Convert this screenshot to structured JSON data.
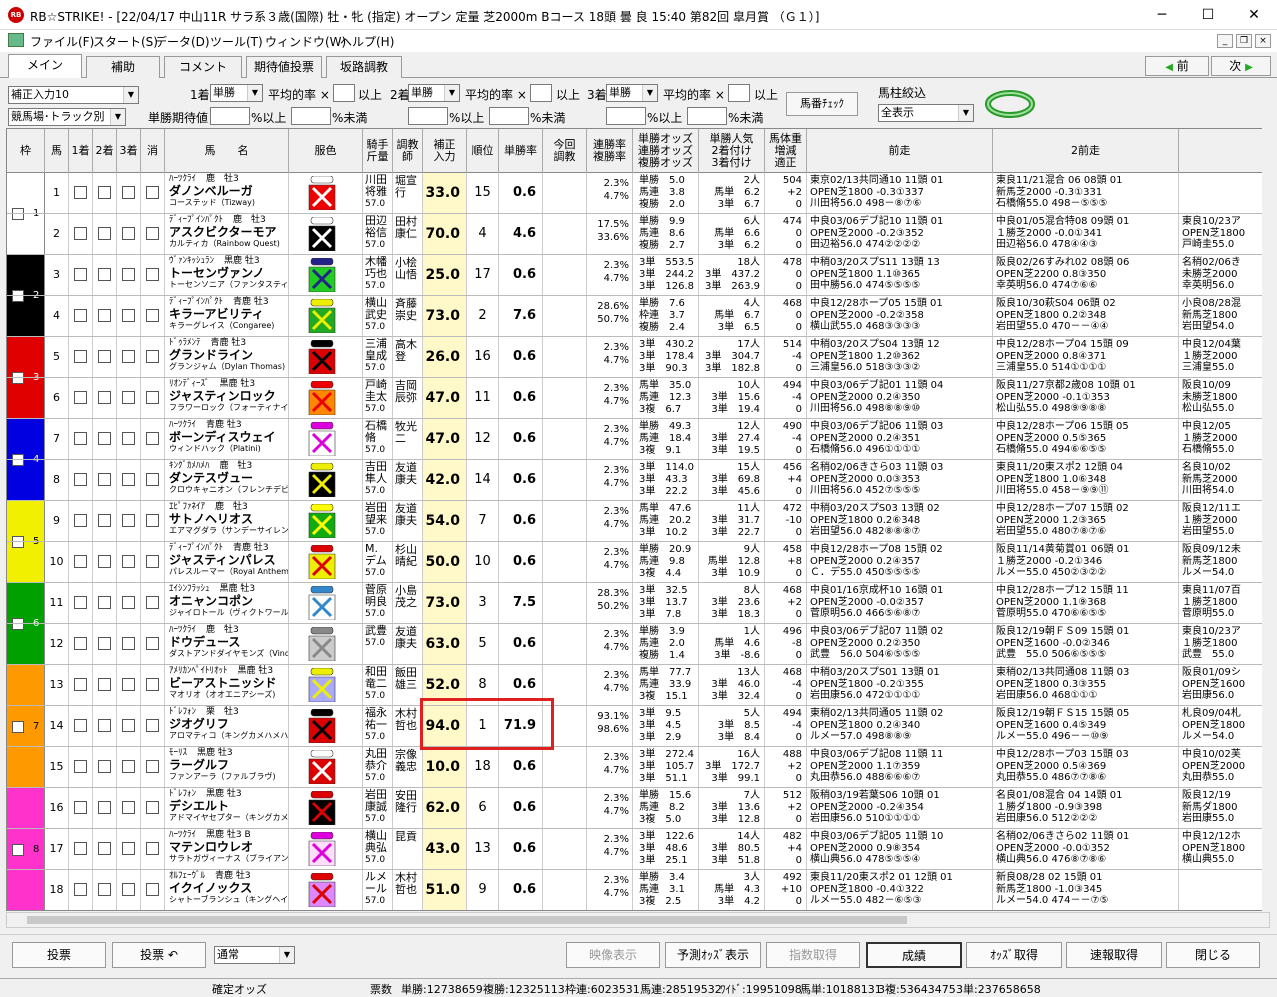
{
  "window": {
    "title": "RB☆STRIKE! - [22/04/17 中山11R サラ系３歳(国際) 牡・牝 (指定) オープン 定量 芝2000m Bコース 18頭 曇 良 15:40 第82回 皐月賞 （Ｇ１）]",
    "icon": "RB"
  },
  "menu": [
    "ファイル(F)",
    "スタート(S)",
    "データ(D)",
    "ツール(T)",
    "ウィンドウ(W)",
    "ヘルプ(H)"
  ],
  "tabs": [
    "メイン",
    "補助",
    "コメント",
    "期待値投票",
    "坂路調教"
  ],
  "nav": {
    "prev": "前",
    "next": "次"
  },
  "controls": {
    "input_mode": "補正入力10",
    "track_mode": "競馬場･トラック別",
    "first": "1着",
    "second": "2着",
    "third": "3着",
    "win": "単勝",
    "avg": "平均的率 ×",
    "above": "以上",
    "win_ev": "単勝期待値",
    "pct_above": "%以上",
    "pct_below": "%未満",
    "horse_check": "馬番ﾁｪｯｸ",
    "filter_label": "馬柱絞込",
    "filter_value": "全表示"
  },
  "headers": {
    "frame": "枠",
    "num": "馬",
    "p1": "1着",
    "p2": "2着",
    "p3": "3着",
    "scratch": "消",
    "name": "馬　　名",
    "silk": "服色",
    "jockey": "騎手\n斤量",
    "trainer": "調教\n師",
    "hosei": "補正\n入力",
    "rank": "順位",
    "win": "単勝率",
    "prev_train": "今回\n調教",
    "place_rate": "連勝率\n複勝率",
    "odds": "単勝オッズ\n連勝オッズ\n複勝オッズ",
    "pop": "単勝人気\n2着付け\n3着付け",
    "weight": "馬体重\n増減\n適正",
    "last1": "前走",
    "last2": "2前走"
  },
  "colors": {
    "f1": "#ffffff",
    "f2": "#000000",
    "f3": "#e00000",
    "f4": "#0000e0",
    "f5": "#f0f000",
    "f6": "#00a000",
    "f7": "#ff9900",
    "f8": "#ff33cc",
    "hosei_bg": "#fff8c8",
    "highlight": "#e02020"
  },
  "frames": [
    {
      "n": "1",
      "color": "#ffffff",
      "rows": 2
    },
    {
      "n": "2",
      "color": "#000000",
      "rows": 2
    },
    {
      "n": "3",
      "color": "#e00000",
      "rows": 2
    },
    {
      "n": "4",
      "color": "#0000e0",
      "rows": 2
    },
    {
      "n": "5",
      "color": "#f0f000",
      "rows": 2
    },
    {
      "n": "6",
      "color": "#00a000",
      "rows": 2
    },
    {
      "n": "7",
      "color": "#ff9900",
      "rows": 3
    },
    {
      "n": "8",
      "color": "#ff33cc",
      "rows": 3
    }
  ],
  "horses": [
    {
      "num": "1",
      "sire": "ﾊｰﾂｸﾗｲ",
      "sex": "鹿　牡3",
      "name": "ダノンベルーガ",
      "dam": "コーステッド（Tizway)",
      "jockey": "川田\n将雅",
      "trainer": "堀宣\n行",
      "wt": "57.0",
      "hosei": "33.0",
      "rank": "15",
      "win": "0.6",
      "rate": "2.3%\n4.7%",
      "odds": "単勝　5.0\n馬連　3.8\n複勝　2.0",
      "pop": "2人\n馬単　6.2\n3単　6.7",
      "bw": "504\n+2\n0",
      "r1": "東京02/13共同通10 11頭 01\nOPEN芝1800 -0.3①337\n川田将56.0 498－⑧⑦⑥",
      "r2": "東良11/21混合 06 08頭 01\n新馬芝2000 -0.3①331\n石橋脩55.0 498－⑤⑤⑤",
      "r3": ""
    },
    {
      "num": "2",
      "sire": "ﾃﾞｨｰﾌﾟｲﾝﾊﾟｸﾄ",
      "sex": "鹿　牡3",
      "name": "アスクビクターモア",
      "dam": "カルティカ（Rainbow Quest)",
      "jockey": "田辺\n裕信",
      "trainer": "田村\n康仁",
      "wt": "57.0",
      "hosei": "70.0",
      "rank": "4",
      "win": "4.6",
      "rate": "17.5%\n33.6%",
      "odds": "単勝　9.9\n馬連　8.6\n複勝　2.7",
      "pop": "6人\n馬単　6.6\n3単　6.2",
      "bw": "474\n0\n0",
      "r1": "中良03/06デブ記10 11頭 01\nOPEN芝2000 -0.2③352\n田辺裕56.0 474②②②②",
      "r2": "中良01/05混合特08 09頭 01\n１勝芝2000 -0.0①341\n田辺裕56.0 478④④③",
      "r3": "東良10/23ア\nOPEN芝1800\n戸崎圭55.0"
    },
    {
      "num": "3",
      "sire": "ｳﾞｧﾝｷｯｼｭﾗﾝ",
      "sex": "黒鹿 牡3",
      "name": "トーセンヴァンノ",
      "dam": "トーセンソニア（ファンタスティックライト)",
      "jockey": "木幡\n巧也",
      "trainer": "小桧\n山悟",
      "wt": "57.0",
      "hosei": "25.0",
      "rank": "17",
      "win": "0.6",
      "rate": "2.3%\n4.7%",
      "odds": "3単　553.5\n3単　244.2\n3単　126.8",
      "pop": "18人\n3単　437.2\n3単　263.9",
      "bw": "478\n0\n0",
      "r1": "中稍03/20スプS11 13頭 13\nOPEN芝1800 1.1⑩365\n田中勝56.0 474⑤⑤⑤⑤",
      "r2": "阪良02/26すみれ02 08頭 06\nOPEN芝2200 0.8③350\n幸英明56.0 474⑦⑥⑥",
      "r3": "名稍02/06き\n未勝芝2000\n幸英明56.0"
    },
    {
      "num": "4",
      "sire": "ﾃﾞｨｰﾌﾟｲﾝﾊﾟｸﾄ",
      "sex": "青鹿 牡3",
      "name": "キラーアビリティ",
      "dam": "キラーグレイス（Congaree)",
      "jockey": "横山\n武史",
      "trainer": "斉藤\n崇史",
      "wt": "57.0",
      "hosei": "73.0",
      "rank": "2",
      "win": "7.6",
      "rate": "28.6%\n50.7%",
      "odds": "単勝　7.6\n枠連　3.7\n複勝　2.4",
      "pop": "4人\n馬単　6.7\n3単　6.5",
      "bw": "468\n0\n0",
      "r1": "中良12/28ホープ05 15頭 01\nOPEN芝2000 -0.2②358\n横山武55.0 468③③③③",
      "r2": "阪良10/30萩S04 06頭 02\nOPEN芝1800 0.2②348\n岩田望55.0 470－－④④",
      "r3": "小良08/28混\n新馬芝1800\n岩田望54.0"
    },
    {
      "num": "5",
      "sire": "ﾄﾞｩﾗﾒﾝﾃ",
      "sex": "青鹿 牡3",
      "name": "グランドライン",
      "dam": "グランジャム（Dylan Thomas)",
      "jockey": "三浦\n皇成",
      "trainer": "高木\n登",
      "wt": "57.0",
      "hosei": "26.0",
      "rank": "16",
      "win": "0.6",
      "rate": "2.3%\n4.7%",
      "odds": "3単　430.2\n3単　178.4\n3単　90.3",
      "pop": "17人\n3単　304.7\n3単　182.8",
      "bw": "514\n-4\n0",
      "r1": "中稍03/20スプS04 13頭 12\nOPEN芝1800 1.2⑩362\n三浦皇56.0 518③③③②",
      "r2": "中良12/28ホープ04 15頭 09\nOPEN芝2000 0.8④371\n三浦皇55.0 514①①①①",
      "r3": "中良12/04葉\n１勝芝2000\n三浦皇55.0"
    },
    {
      "num": "6",
      "sire": "ﾘｵﾝﾃﾞｨｰｽﾞ",
      "sex": "黒鹿 牡3",
      "name": "ジャスティンロック",
      "dam": "フラワーロック（フォーティナイナー)",
      "jockey": "戸崎\n圭太",
      "trainer": "吉岡\n辰弥",
      "wt": "57.0",
      "hosei": "47.0",
      "rank": "11",
      "win": "0.6",
      "rate": "2.3%\n4.7%",
      "odds": "馬単　35.0\n馬連　12.3\n3複　6.7",
      "pop": "10人\n3単　15.6\n3単　19.4",
      "bw": "494\n-4\n0",
      "r1": "中良03/06デブ記01 11頭 04\nOPEN芝2000 0.2④350\n川田将56.0 498⑧⑧⑨⑩",
      "r2": "阪良11/27京都2歳08 10頭 01\nOPEN芝2000 -0.1①353\n松山弘55.0 498⑨⑨⑧⑧",
      "r3": "阪良10/09\n未勝芝1800\n松山弘55.0"
    },
    {
      "num": "7",
      "sire": "ﾊｰﾂｸﾗｲ",
      "sex": "青鹿 牡3",
      "name": "ボーンディスウェイ",
      "dam": "ウィンドハック（Platini)",
      "jockey": "石橋\n脩",
      "trainer": "牧光\n二",
      "wt": "57.0",
      "hosei": "47.0",
      "rank": "12",
      "win": "0.6",
      "rate": "2.3%\n4.7%",
      "odds": "単勝　49.3\n馬連　18.4\n3複　9.1",
      "pop": "12人\n3単　27.4\n3単　19.5",
      "bw": "490\n-4\n0",
      "r1": "中良03/06デブ記06 11頭 03\nOPEN芝2000 0.2④351\n石橋脩56.0 496①①①①",
      "r2": "中良12/28ホープ06 15頭 05\nOPEN芝2000 0.5⑤365\n石橋脩55.0 494⑥⑥⑤⑤",
      "r3": "中良12/05\n１勝芝2000\n石橋脩55.0"
    },
    {
      "num": "8",
      "sire": "ｷﾝｸﾞｶﾒﾊﾒﾊ",
      "sex": "鹿　牡3",
      "name": "ダンテスヴュー",
      "dam": "クロウキャニオン（フレンチデピュティ)",
      "jockey": "吉田\n隼人",
      "trainer": "友道\n康夫",
      "wt": "57.0",
      "hosei": "42.0",
      "rank": "14",
      "win": "0.6",
      "rate": "2.3%\n4.7%",
      "odds": "3単　114.0\n3単　43.3\n3単　22.2",
      "pop": "15人\n3単　69.8\n3単　45.6",
      "bw": "456\n+4\n0",
      "r1": "名稍02/06きさら03 11頭 03\nOPEN芝2000 0.0③353\n川田将56.0 452⑦⑤⑤⑤",
      "r2": "東良11/20東スポ2 12頭 04\nOPEN芝1800 1.0⑥348\n川田将55.0 458－⑨⑨⑪",
      "r3": "名良10/02\n新馬芝2000\n川田将54.0"
    },
    {
      "num": "9",
      "sire": "ｴﾋﾟﾌｧﾈｲｱ",
      "sex": "鹿　牡3",
      "name": "サトノヘリオス",
      "dam": "エアマグダラ（サンデーサイレンス)",
      "jockey": "岩田\n望来",
      "trainer": "友道\n康夫",
      "wt": "57.0",
      "hosei": "54.0",
      "rank": "7",
      "win": "0.6",
      "rate": "2.3%\n4.7%",
      "odds": "馬単　47.6\n馬連　20.2\n3単　10.2",
      "pop": "11人\n3単　31.7\n3単　22.7",
      "bw": "472\n-10\n0",
      "r1": "中稍03/20スプS03 13頭 02\nOPEN芝1800 0.2⑥348\n岩田望56.0 482⑧⑧⑧⑦",
      "r2": "中良12/28ホープ07 15頭 02\nOPEN芝2000 1.2③365\n岩田望55.0 480⑦⑧⑦⑥",
      "r3": "阪良12/11エ\n１勝芝2000\n岩田望55.0"
    },
    {
      "num": "10",
      "sire": "ﾃﾞｨｰﾌﾟｲﾝﾊﾟｸﾄ",
      "sex": "青鹿 牡3",
      "name": "ジャスティンパレス",
      "dam": "パレスルーマー（Royal Anthem)",
      "jockey": "M.\nデム",
      "trainer": "杉山\n晴紀",
      "wt": "57.0",
      "hosei": "50.0",
      "rank": "10",
      "win": "0.6",
      "rate": "2.3%\n4.7%",
      "odds": "単勝　20.9\n馬連　9.8\n3複　4.4",
      "pop": "9人\n馬単　12.8\n3単　10.9",
      "bw": "458\n+8\n0",
      "r1": "中良12/28ホープ08 15頭 02\nOPEN芝2000 0.2④357\nＣ．デ55.0 450⑤⑤⑤⑤",
      "r2": "阪良11/14黄菊賞01 06頭 01\n１勝芝2000 -0.2①346\nルメー55.0 450②③②②",
      "r3": "阪良09/12未\n新馬芝1800\nルメー54.0"
    },
    {
      "num": "11",
      "sire": "ｴｲｼﾝﾌﾗｯｼｭ",
      "sex": "黒鹿 牡3",
      "name": "オニャンコポン",
      "dam": "ジャイロトール（ヴィクトワールピサ)",
      "jockey": "菅原\n明良",
      "trainer": "小島\n茂之",
      "wt": "57.0",
      "hosei": "73.0",
      "rank": "3",
      "win": "7.5",
      "rate": "28.3%\n50.2%",
      "odds": "3単　32.5\n3単　13.7\n3単　7.8",
      "pop": "8人\n3単　23.6\n3単　18.3",
      "bw": "468\n+2\n0",
      "r1": "中良01/16京成杯10 16頭 01\nOPEN芝2000 -0.0②357\n菅原明56.0 466⑤⑥⑧⑦",
      "r2": "中良12/28ホープ12 15頭 11\nOPEN芝2000 1.1⑨368\n菅原明55.0 470⑥⑥⑤⑤",
      "r3": "東良11/07百\n１勝芝1800\n菅原明55.0"
    },
    {
      "num": "12",
      "sire": "ﾊｰﾂｸﾗｲ",
      "sex": "鹿　牡3",
      "name": "ドウデュース",
      "dam": "ダストアンドダイヤモンズ（Vindica",
      "jockey": "武豊",
      "trainer": "友道\n康夫",
      "wt": "57.0",
      "hosei": "63.0",
      "rank": "5",
      "win": "0.6",
      "rate": "2.3%\n4.7%",
      "odds": "単勝　3.9\n馬連　2.0\n複勝　1.4",
      "pop": "1人\n馬単　4.6\n3単　-8.6",
      "bw": "496\n-8\n0",
      "r1": "中良03/06デブ記07 11頭 02\nOPEN芝2000 0.2②350\n武豊　56.0 504⑥⑤⑤⑤",
      "r2": "阪良12/19朝ＦＳ09 15頭 01\nOPEN芝1600 -0.0②346\n武豊　55.0 506⑥⑤⑤⑤",
      "r3": "東良10/23ア\n１勝芝1800\n武豊　55.0"
    },
    {
      "num": "13",
      "sire": "ｱﾒﾘｶﾝﾍﾟｲﾄﾘｵｯﾄ",
      "sex": "黒鹿 牡3",
      "name": "ビーアストニッシド",
      "dam": "マオリオ（オオエニアシーズ)",
      "jockey": "和田\n竜二",
      "trainer": "飯田\n雄三",
      "wt": "57.0",
      "hosei": "52.0",
      "rank": "8",
      "win": "0.6",
      "rate": "2.3%\n4.7%",
      "odds": "馬単　77.7\n馬連　33.9\n3複　15.1",
      "pop": "13人\n3単　46.0\n3単　32.4",
      "bw": "468\n-4\n0",
      "r1": "中稍03/20スプS01 13頭 01\nOPEN芝1800 -0.2①355\n岩田康56.0 472①①①①",
      "r2": "東稍02/13共同通08 11頭 03\nOPEN芝1800 0.3③355\n岩田康56.0 468①①①",
      "r3": "阪良01/09シ\nOPEN芝1600\n岩田康56.0"
    },
    {
      "num": "14",
      "sire": "ﾄﾞﾚﾌｫﾝ",
      "sex": "栗　牡3",
      "name": "ジオグリフ",
      "dam": "アロマティコ（キングカメハメハ)",
      "jockey": "福永\n祐一",
      "trainer": "木村\n哲也",
      "wt": "57.0",
      "hosei": "94.0",
      "rank": "1",
      "win": "71.9",
      "rate": "93.1%\n98.6%",
      "odds": "3単　9.5\n3単　4.5\n3単　2.9",
      "pop": "5人\n3単　8.5\n3単　8.4",
      "bw": "494\n-4\n0",
      "r1": "東稍02/13共同通05 11頭 02\nOPEN芝1800 0.2④340\nルメー57.0 498⑧⑧⑨",
      "r2": "阪良12/19朝ＦＳ15 15頭 05\nOPEN芝1600 0.4⑤349\nルメー55.0 496－－⑩⑨",
      "r3": "札良09/04札\nOPEN芝1800\nルメー54.0"
    },
    {
      "num": "15",
      "sire": "ﾓｰﾘｽ",
      "sex": "黒鹿 牡3",
      "name": "ラーグルフ",
      "dam": "ファンアーラ（ファルブラヴ)",
      "jockey": "丸田\n恭介",
      "trainer": "宗像\n義忠",
      "wt": "57.0",
      "hosei": "10.0",
      "rank": "18",
      "win": "0.6",
      "rate": "2.3%\n4.7%",
      "odds": "3単　272.4\n3単　105.7\n3単　51.1",
      "pop": "16人\n3単　172.7\n3単　99.1",
      "bw": "488\n+2\n0",
      "r1": "中良03/06デブ記08 11頭 11\nOPEN芝2000 1.1⑦359\n丸田恭56.0 488⑥⑥⑥⑦",
      "r2": "中良12/28ホープ03 15頭 03\nOPEN芝2000 0.5④369\n丸田恭55.0 486⑦⑦⑧⑥",
      "r3": "中良10/02芙\nOPEN芝2000\n丸田恭55.0"
    },
    {
      "num": "16",
      "sire": "ﾄﾞﾚﾌｫﾝ",
      "sex": "黒鹿 牡3",
      "name": "デシエルト",
      "dam": "アドマイヤセプター（キングカメハメハ)",
      "jockey": "岩田\n康誠",
      "trainer": "安田\n隆行",
      "wt": "57.0",
      "hosei": "62.0",
      "rank": "6",
      "win": "0.6",
      "rate": "2.3%\n4.7%",
      "odds": "単勝　15.6\n馬連　8.2\n3複　5.0",
      "pop": "7人\n3単　13.6\n3単　12.8",
      "bw": "512\n+2\n0",
      "r1": "阪稍03/19若葉S06 10頭 01\nOPEN芝2000 -0.2④354\n岩田康56.0 510①①①①",
      "r2": "名良01/08混合 04 14頭 01\n１勝ダ1800 -0.9③398\n岩田康56.0 512②②②",
      "r3": "阪良12/19\n新馬ダ1800\n岩田康55.0"
    },
    {
      "num": "17",
      "sire": "ﾊｰﾂｸﾗｲ",
      "sex": "黒鹿 牡3 B",
      "name": "マテンロウレオ",
      "dam": "サラトガヴィーナス（ブライアンズタイム)",
      "jockey": "横山\n典弘",
      "trainer": "昆貢",
      "wt": "57.0",
      "hosei": "43.0",
      "rank": "13",
      "win": "0.6",
      "rate": "2.3%\n4.7%",
      "odds": "3単　122.6\n3単　48.6\n3単　25.1",
      "pop": "14人\n3単　80.5\n3単　51.8",
      "bw": "482\n+4\n0",
      "r1": "中良03/06デブ記05 11頭 10\nOPEN芝2000 0.9⑧354\n横山典56.0 478⑤⑤⑤④",
      "r2": "名稍02/06きさら02 11頭 01\nOPEN芝2000 -0.0①352\n横山典56.0 476⑧⑦⑧⑥",
      "r3": "中良12/12ホ\nOPEN芝1800\n横山典55.0"
    },
    {
      "num": "18",
      "sire": "ｵﾙﾌｪｰｳﾞﾙ",
      "sex": "青鹿 牡3",
      "name": "イクイノックス",
      "dam": "シャトーブランシュ（キングヘイロー)",
      "jockey": "ルメ\nール",
      "trainer": "木村\n哲也",
      "wt": "57.0",
      "hosei": "51.0",
      "rank": "9",
      "win": "0.6",
      "rate": "2.3%\n4.7%",
      "odds": "単勝　3.4\n馬連　3.1\n3複　2.5",
      "pop": "3人\n馬単　4.3\n3単　4.2",
      "bw": "492\n+10\n0",
      "r1": "東良11/20東スポ2 01 12頭 01\nOPEN芝1800 -0.4①322\nルメー55.0 482－⑥⑤③",
      "r2": "新良08/28 02 15頭 01\n新馬芝1800 -1.0③345\nルメー54.0 474－－⑦⑤",
      "r3": ""
    }
  ],
  "bottom": {
    "vote": "投票",
    "vote_back": "投票 ↶",
    "mode": "通常",
    "video": "映像表示",
    "pred_odds": "予測ｵｯｽﾞ表示",
    "index_get": "指数取得",
    "results": "成績",
    "odds_get": "ｵｯｽﾞ取得",
    "quick": "速報取得",
    "close": "閉じる"
  },
  "status": {
    "confirmed": "確定オッズ",
    "votes": "票数",
    "win": "単勝:12738659",
    "place": "複勝:12325113",
    "bracket": "枠連:6023531",
    "quinella": "馬連:28519532",
    "wide": "ﾜｲﾄﾞ:19951098",
    "exacta": "馬単:10188131",
    "trio": "3複:53643475",
    "trifecta": "3単:237658658"
  }
}
